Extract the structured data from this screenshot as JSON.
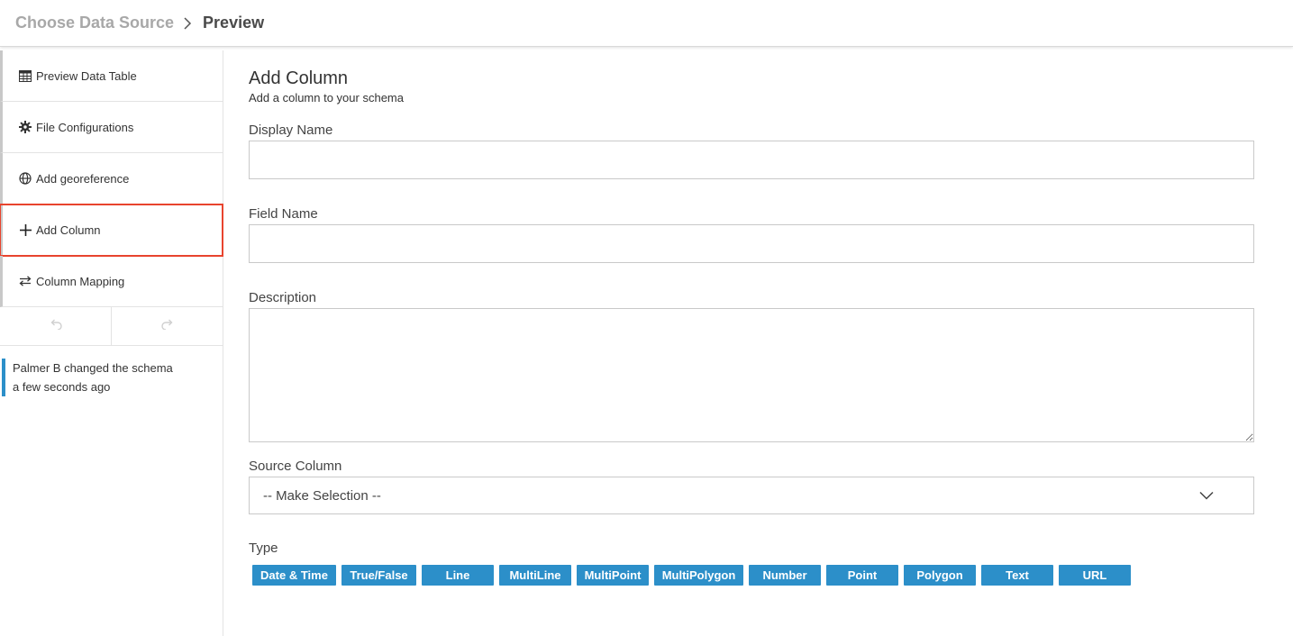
{
  "breadcrumb": {
    "step1": "Choose Data Source",
    "step2": "Preview"
  },
  "sidebar": {
    "items": [
      {
        "label": "Preview Data Table",
        "icon": "table-icon"
      },
      {
        "label": "File Configurations",
        "icon": "gear-icon"
      },
      {
        "label": "Add georeference",
        "icon": "globe-icon"
      },
      {
        "label": "Add Column",
        "icon": "plus-icon"
      },
      {
        "label": "Column Mapping",
        "icon": "swap-arrows-icon"
      }
    ],
    "activity": {
      "line1": "Palmer B changed the schema",
      "line2": "a few seconds ago"
    }
  },
  "form": {
    "title": "Add Column",
    "subtitle": "Add a column to your schema",
    "display_name_label": "Display Name",
    "display_name_value": "",
    "field_name_label": "Field Name",
    "field_name_value": "",
    "description_label": "Description",
    "description_value": "",
    "source_column_label": "Source Column",
    "source_column_value": "-- Make Selection --",
    "type_label": "Type",
    "types": [
      "Date & Time",
      "True/False",
      "Line",
      "MultiLine",
      "MultiPoint",
      "MultiPolygon",
      "Number",
      "Point",
      "Polygon",
      "Text",
      "URL"
    ]
  },
  "colors": {
    "accent": "#2c8fc9",
    "highlight": "#e8442e"
  }
}
